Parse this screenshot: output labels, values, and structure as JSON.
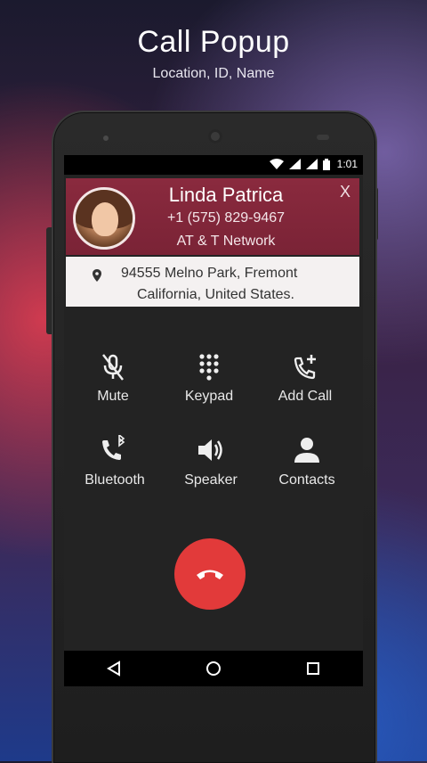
{
  "header": {
    "title": "Call Popup",
    "subtitle": "Location, ID, Name"
  },
  "statusbar": {
    "time": "1:01",
    "icons": [
      "wifi-icon",
      "signal-icon",
      "signal-icon",
      "battery-icon"
    ]
  },
  "caller": {
    "name": "Linda Patrica",
    "number": "+1 (575) 829-9467",
    "network": "AT & T Network",
    "close_label": "X"
  },
  "location": {
    "line1": "94555 Melno Park, Fremont",
    "line2": "California, United States."
  },
  "controls": [
    {
      "label": "Mute",
      "icon": "mic-off-icon"
    },
    {
      "label": "Keypad",
      "icon": "keypad-icon"
    },
    {
      "label": "Add Call",
      "icon": "add-call-icon"
    },
    {
      "label": "Bluetooth",
      "icon": "bluetooth-call-icon"
    },
    {
      "label": "Speaker",
      "icon": "speaker-icon"
    },
    {
      "label": "Contacts",
      "icon": "contacts-icon"
    }
  ],
  "end_call": {
    "icon": "end-call-icon",
    "color": "#e23a3a"
  },
  "navbar": {
    "icons": [
      "back-icon",
      "home-icon",
      "recents-icon"
    ]
  },
  "colors": {
    "popup_header": "#7f2539",
    "end_call": "#e23a3a"
  }
}
